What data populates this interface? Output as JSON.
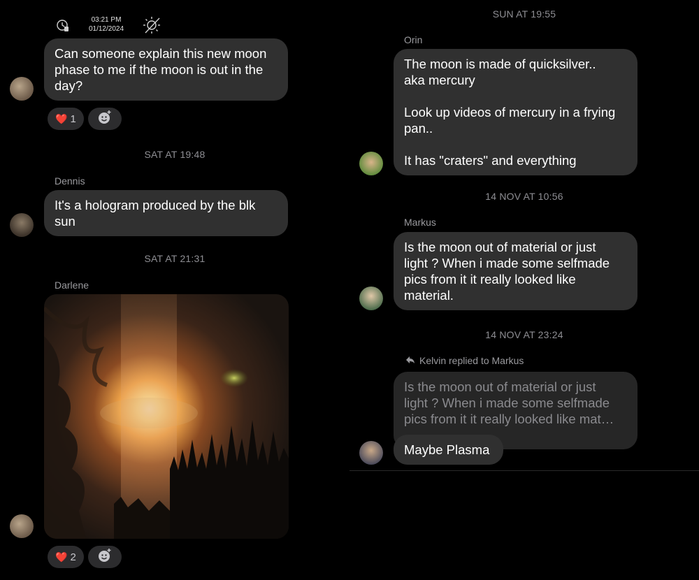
{
  "left": {
    "status": {
      "time": "03:21 PM",
      "date": "01/12/2024"
    },
    "message1": {
      "lines": [
        "Can someone explain this new moon",
        "phase to me if the moon is out in the",
        "day?"
      ],
      "reaction_emoji": "❤️",
      "reaction_count": "1"
    },
    "timestamp1": "SAT AT 19:48",
    "message2": {
      "sender": "Dennis",
      "lines": [
        "It's a hologram produced by the blk",
        "sun"
      ]
    },
    "timestamp2": "SAT AT 21:31",
    "message3": {
      "sender": "Darlene",
      "reaction_emoji": "❤️",
      "reaction_count": "2"
    }
  },
  "right": {
    "timestamp0": "SUN AT 19:55",
    "message1": {
      "sender": "Orin",
      "lines": [
        "The moon is made of quicksilver..",
        "aka mercury",
        "",
        "Look up videos of mercury in a frying",
        "pan..",
        "",
        "It has \"craters\" and everything"
      ]
    },
    "timestamp1": "14 NOV AT 10:56",
    "message2": {
      "sender": "Markus",
      "lines": [
        "Is the moon out of material or just",
        "light ? When i made some selfmade",
        "pics from it it really looked like",
        "material."
      ]
    },
    "timestamp2": "14 NOV AT 23:24",
    "message3": {
      "reply_label": "Kelvin replied to Markus",
      "quoted_lines": [
        "Is the moon out of material or just",
        "light ? When i made some selfmade",
        "pics from it it really looked like mat…"
      ],
      "text": "Maybe Plasma"
    }
  },
  "colors": {
    "background": "#000000",
    "bubble": "#303030",
    "muted_text": "#8e8e93",
    "heart": "#e0245e"
  }
}
